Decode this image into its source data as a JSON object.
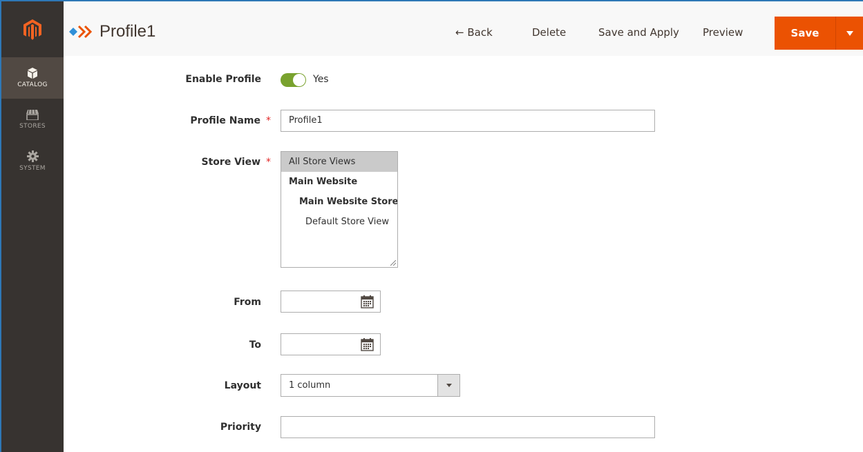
{
  "sidebar": {
    "items": [
      {
        "label": "CATALOG",
        "icon": "cube-icon",
        "active": true
      },
      {
        "label": "STORES",
        "icon": "store-icon",
        "active": false
      },
      {
        "label": "SYSTEM",
        "icon": "gear-icon",
        "active": false
      }
    ]
  },
  "header": {
    "title": "Profile1",
    "back_label": "← Back",
    "delete_label": "Delete",
    "save_apply_label": "Save and Apply",
    "preview_label": "Preview",
    "save_label": "Save"
  },
  "form": {
    "enable_profile": {
      "label": "Enable Profile",
      "value": "Yes",
      "enabled": true
    },
    "profile_name": {
      "label": "Profile Name",
      "required_mark": "*",
      "value": "Profile1"
    },
    "store_view": {
      "label": "Store View",
      "required_mark": "*",
      "options": [
        {
          "text": "All Store Views",
          "selected": true,
          "bold": false,
          "indent": 0
        },
        {
          "text": "Main Website",
          "selected": false,
          "bold": true,
          "indent": 1
        },
        {
          "text": "Main Website Store",
          "selected": false,
          "bold": true,
          "indent": 2
        },
        {
          "text": "Default Store View",
          "selected": false,
          "bold": false,
          "indent": 3
        }
      ]
    },
    "from": {
      "label": "From",
      "value": ""
    },
    "to": {
      "label": "To",
      "value": ""
    },
    "layout": {
      "label": "Layout",
      "value": "1 column"
    },
    "priority": {
      "label": "Priority",
      "value": ""
    }
  },
  "colors": {
    "accent": "#eb5202",
    "sidebar": "#373330",
    "toggle_on": "#79a22e"
  }
}
